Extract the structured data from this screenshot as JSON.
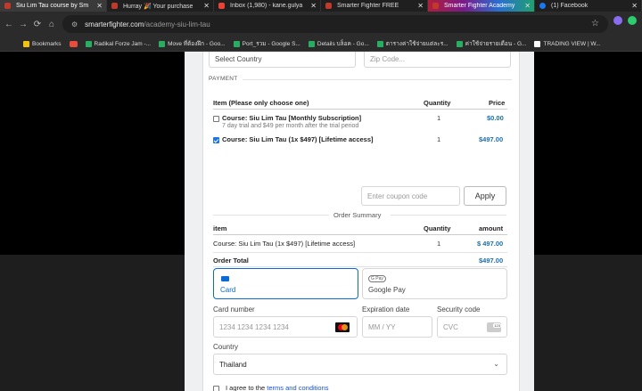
{
  "tabs": [
    {
      "label": "Siu Lim Tau course by Sm",
      "icon_color": "#c0392b",
      "state": "active"
    },
    {
      "label": "Hurray 🎉 Your purchase",
      "icon_color": "#c0392b",
      "state": "normal"
    },
    {
      "label": "Inbox (1,980) - kane.gulya",
      "icon_color": "#ea4335",
      "state": "normal"
    },
    {
      "label": "Smarter Fighter FREE",
      "icon_color": "#c0392b",
      "state": "normal"
    },
    {
      "label": "Smarter Fighter Academy",
      "icon_color": "#c0392b",
      "state": "highlight"
    },
    {
      "label": "(1) Facebook",
      "icon_color": "#1877f2",
      "state": "normal"
    }
  ],
  "tab_close": "✕",
  "nav": {
    "back": "←",
    "forward": "→",
    "reload": "⟳",
    "home": "⌂"
  },
  "address": {
    "host": "smarterfighter.com",
    "path": "/academy-siu-lim-tau"
  },
  "bookmarks": [
    {
      "label": "Bookmarks",
      "icon_color": "#f1c40f"
    },
    {
      "label": "",
      "icon_color": "#e74c3c"
    },
    {
      "label": "Radikal Forze Jam -...",
      "icon_color": "#27ae60"
    },
    {
      "label": "Move ที่ต้องฝึก - Goo...",
      "icon_color": "#27ae60"
    },
    {
      "label": "Port_รวม - Google S...",
      "icon_color": "#27ae60"
    },
    {
      "label": "Details บล็อค - Go...",
      "icon_color": "#27ae60"
    },
    {
      "label": "ตารางค่าใช้จ่ายแต่ละร...",
      "icon_color": "#27ae60"
    },
    {
      "label": "ค่าใช้จ่ายรายเดือน - G...",
      "icon_color": "#27ae60"
    },
    {
      "label": "TRADING VIEW | W...",
      "icon_color": "#ffffff"
    }
  ],
  "billing": {
    "country_placeholder": "Select Country",
    "zip_placeholder": "Zip Code..."
  },
  "payment": {
    "section_title": "PAYMENT",
    "headers": {
      "item": "Item (Please only choose one)",
      "quantity": "Quantity",
      "price": "Price"
    },
    "items": [
      {
        "name": "Course: Siu Lim Tau [Monthly Subscription]",
        "sub": "7 day trial and $49 per month after the trial period",
        "qty": "1",
        "price": "$0.00",
        "checked": false
      },
      {
        "name": "Course: Siu Lim Tau (1x $497) [Lifetime access]",
        "sub": "",
        "qty": "1",
        "price": "$497.00",
        "checked": true
      }
    ],
    "coupon_placeholder": "Enter coupon code",
    "apply_label": "Apply"
  },
  "summary": {
    "title": "Order Summary",
    "headers": {
      "item": "item",
      "quantity": "Quantity",
      "amount": "amount"
    },
    "row": {
      "item": "Course: Siu Lim Tau (1x $497) [Lifetime access]",
      "qty": "1",
      "amount": "$ 497.00"
    },
    "total_label": "Order Total",
    "total_amount": "$497.00"
  },
  "methods": {
    "card_label": "Card",
    "gpay_label": "Google Pay",
    "gpay_badge": "G Pay"
  },
  "card_form": {
    "number_label": "Card number",
    "number_placeholder": "1234 1234 1234 1234",
    "expiry_label": "Expiration date",
    "expiry_placeholder": "MM / YY",
    "cvc_label": "Security code",
    "cvc_placeholder": "CVC",
    "cvc_badge": "123",
    "country_label": "Country",
    "country_value": "Thailand"
  },
  "terms": {
    "prefix": "I agree to the ",
    "link": "terms and conditions"
  }
}
